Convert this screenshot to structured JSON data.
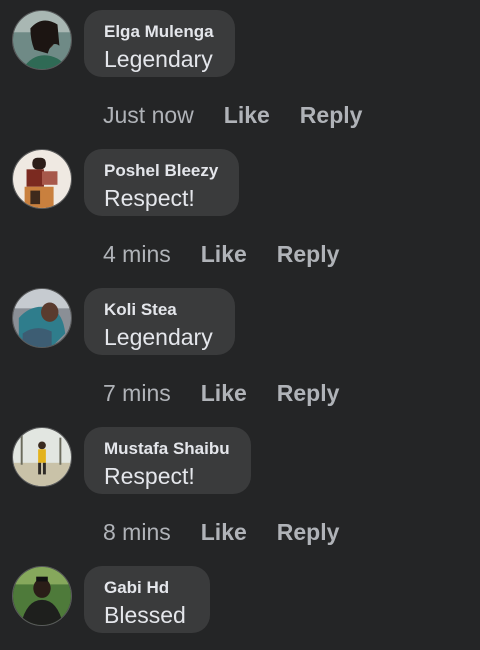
{
  "comments": [
    {
      "author": "Elga Mulenga",
      "text": "Legendary",
      "time": "Just now",
      "like_label": "Like",
      "reply_label": "Reply"
    },
    {
      "author": "Poshel Bleezy",
      "text": "Respect!",
      "time": "4 mins",
      "like_label": "Like",
      "reply_label": "Reply"
    },
    {
      "author": "Koli Stea",
      "text": "Legendary",
      "time": "7 mins",
      "like_label": "Like",
      "reply_label": "Reply"
    },
    {
      "author": "Mustafa Shaibu",
      "text": "Respect!",
      "time": "8 mins",
      "like_label": "Like",
      "reply_label": "Reply"
    },
    {
      "author": "Gabi Hd",
      "text": "Blessed"
    }
  ],
  "colors": {
    "background": "#242526",
    "bubble": "#3a3b3c",
    "primary_text": "#e4e6eb",
    "secondary_text": "#b0b3b8"
  }
}
